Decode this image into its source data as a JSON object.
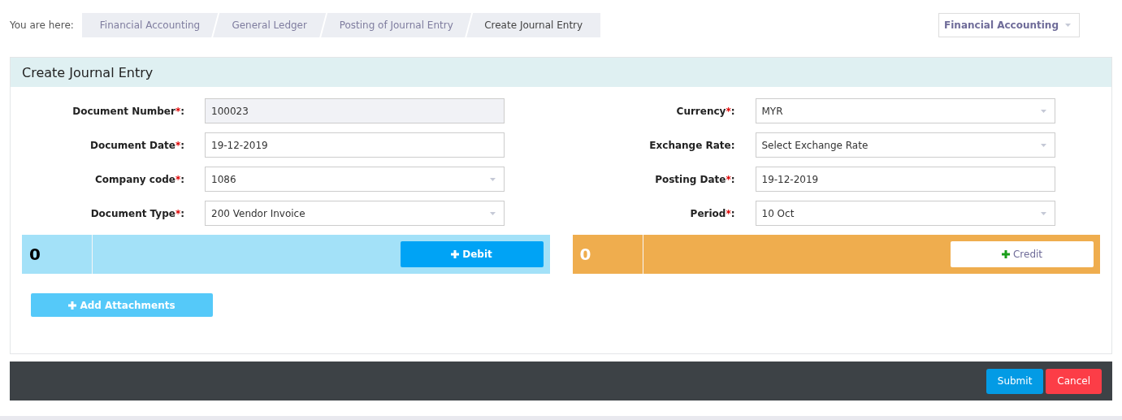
{
  "breadcrumb": {
    "label": "You are here:",
    "items": [
      {
        "label": "Financial Accounting",
        "selected": false
      },
      {
        "label": "General Ledger",
        "selected": false
      },
      {
        "label": "Posting of Journal Entry",
        "selected": false
      },
      {
        "label": "Create Journal Entry",
        "selected": true
      }
    ]
  },
  "module_dropdown": {
    "value": "Financial Accounting"
  },
  "form": {
    "title": "Create Journal Entry",
    "left_fields": [
      {
        "label": "Document Number",
        "required_mark": "*",
        "label_end": ":",
        "kind": "input",
        "value": "100023",
        "disabled": true
      },
      {
        "label": "Document Date",
        "required_mark": "*",
        "label_end": ":",
        "kind": "input",
        "value": "19-12-2019",
        "disabled": false
      },
      {
        "label": "Company code",
        "required_mark": "*",
        "label_end": ":",
        "kind": "select",
        "value": "1086",
        "disabled": false
      },
      {
        "label": "Document Type",
        "required_mark": "*",
        "label_end": ":",
        "kind": "select",
        "value": "200 Vendor Invoice",
        "disabled": false
      }
    ],
    "right_fields": [
      {
        "label": "Currency",
        "required_mark": "*",
        "label_end": ":",
        "kind": "select",
        "value": "MYR",
        "disabled": false
      },
      {
        "label": "Exchange Rate",
        "label_end": ":",
        "kind": "select",
        "value": "Select Exchange Rate",
        "disabled": false
      },
      {
        "label": "Posting Date",
        "required_mark": "*",
        "label_end": ":",
        "kind": "input",
        "value": "19-12-2019",
        "disabled": false
      },
      {
        "label": "Period",
        "required_mark": "*",
        "label_end": ":",
        "kind": "select",
        "value": "10 Oct",
        "disabled": false
      }
    ],
    "debit": {
      "total": "0",
      "button": "Debit"
    },
    "credit": {
      "total": "0",
      "button": "Credit"
    },
    "attachments_button": "Add Attachments"
  },
  "footer": {
    "buttons": [
      {
        "label": "Submit",
        "kind": "primary"
      },
      {
        "label": "Cancel",
        "kind": "danger"
      }
    ]
  }
}
